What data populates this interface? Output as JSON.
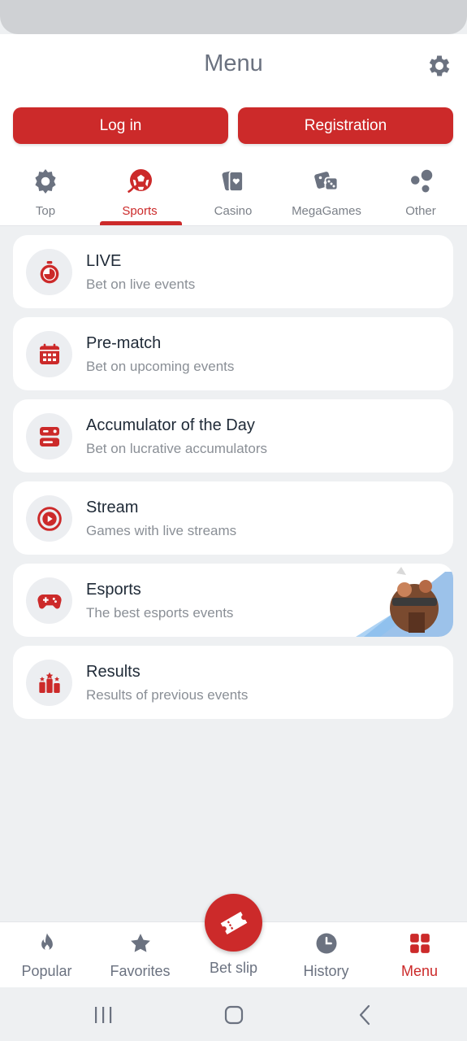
{
  "header": {
    "title": "Menu",
    "settings_icon": "gear-icon"
  },
  "auth": {
    "login_label": "Log in",
    "register_label": "Registration"
  },
  "tabs": [
    {
      "label": "Top",
      "icon": "cog-icon",
      "active": false
    },
    {
      "label": "Sports",
      "icon": "soccer-ball-icon",
      "active": true
    },
    {
      "label": "Casino",
      "icon": "playing-cards-icon",
      "active": false
    },
    {
      "label": "MegaGames",
      "icon": "dice-icon",
      "active": false
    },
    {
      "label": "Other",
      "icon": "bubbles-icon",
      "active": false
    }
  ],
  "menu_items": [
    {
      "title": "LIVE",
      "subtitle": "Bet on live events",
      "icon": "stopwatch-icon"
    },
    {
      "title": "Pre-match",
      "subtitle": "Bet on upcoming events",
      "icon": "calendar-icon"
    },
    {
      "title": "Accumulator of the Day",
      "subtitle": "Bet on lucrative accumulators",
      "icon": "accumulator-icon"
    },
    {
      "title": "Stream",
      "subtitle": "Games with live streams",
      "icon": "play-circle-icon"
    },
    {
      "title": "Esports",
      "subtitle": "The best esports events",
      "icon": "gamepad-icon"
    },
    {
      "title": "Results",
      "subtitle": "Results of previous events",
      "icon": "podium-icon"
    }
  ],
  "bottom_nav": [
    {
      "label": "Popular",
      "icon": "flame-icon",
      "active": false
    },
    {
      "label": "Favorites",
      "icon": "star-icon",
      "active": false
    },
    {
      "label": "Bet slip",
      "icon": "ticket-icon",
      "active": false
    },
    {
      "label": "History",
      "icon": "clock-icon",
      "active": false
    },
    {
      "label": "Menu",
      "icon": "grid-icon",
      "active": true
    }
  ],
  "colors": {
    "accent": "#cc2a2a",
    "muted": "#6b7280",
    "background": "#eef0f2",
    "card": "#ffffff"
  }
}
